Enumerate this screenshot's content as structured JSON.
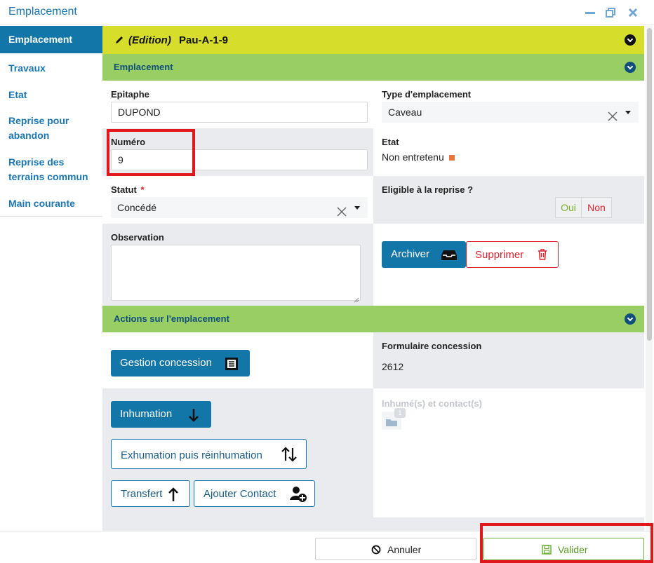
{
  "window": {
    "title": "Emplacement"
  },
  "sidebar": {
    "items": [
      {
        "label": "Emplacement"
      },
      {
        "label": "Travaux"
      },
      {
        "label": "Etat"
      },
      {
        "label": "Reprise pour abandon"
      },
      {
        "label": "Reprise des terrains commun"
      },
      {
        "label": "Main courante"
      }
    ]
  },
  "header": {
    "mode": "(Edition)",
    "code": "Pau-A-1-9"
  },
  "section_emplacement": {
    "title": "Emplacement"
  },
  "fields": {
    "epitaphe": {
      "label": "Epitaphe",
      "value": "DUPOND"
    },
    "type": {
      "label": "Type d'emplacement",
      "value": "Caveau"
    },
    "numero": {
      "label": "Numéro",
      "value": "9"
    },
    "etat": {
      "label": "Etat",
      "value": "Non entretenu"
    },
    "statut": {
      "label": "Statut",
      "required": "*",
      "value": "Concédé"
    },
    "eligible": {
      "label": "Eligible à la reprise ?",
      "oui": "Oui",
      "non": "Non"
    },
    "observation": {
      "label": "Observation",
      "value": ""
    }
  },
  "buttons": {
    "archiver": "Archiver",
    "supprimer": "Supprimer"
  },
  "section_actions": {
    "title": "Actions sur l'emplacement"
  },
  "actions": {
    "gestion": "Gestion concession",
    "formulaire_label": "Formulaire concession",
    "formulaire_value": "2612",
    "inhumation": "Inhumation",
    "exhumation": "Exhumation puis réinhumation",
    "transfert": "Transfert",
    "ajouter_contact": "Ajouter Contact",
    "inhumes_label": "Inhumé(s) et contact(s)",
    "inhumes_count": "1"
  },
  "footer": {
    "annuler": "Annuler",
    "valider": "Valider"
  },
  "colors": {
    "brand_blue": "#1276a8",
    "header_yellow": "#d6dd2b",
    "section_green": "#99ce65",
    "etat_orange": "#e8763a",
    "highlight_red": "#e0171b"
  }
}
